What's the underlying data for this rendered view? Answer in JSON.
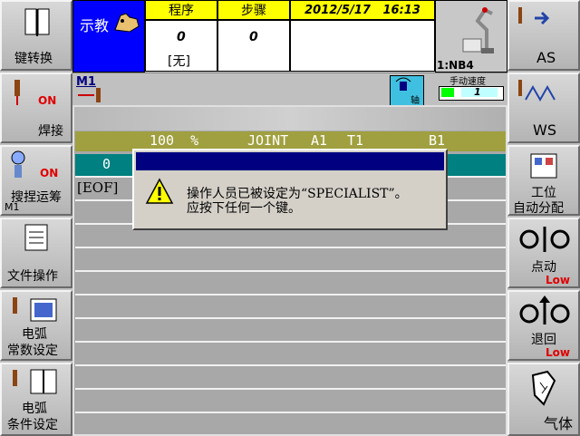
{
  "header": {
    "mode_label": "示教",
    "program_label": "程序",
    "program_value": "0",
    "program_name": "[无]",
    "step_label": "步骤",
    "step_value": "0",
    "datetime": "2012/5/17   16:13",
    "robot_label": "1:NB4",
    "speed_label": "手动速度",
    "speed_value": "1",
    "coord_label": "轴"
  },
  "subheader": {
    "m1_label": "M1"
  },
  "program_view": {
    "status_line": {
      "override": "100  %",
      "coord": "JOINT",
      "axis": "A1",
      "tool": "T1",
      "base": "B1"
    },
    "row0_number": "0",
    "eof_label": "[EOF]"
  },
  "dialog": {
    "message_line1": "操作人员已被设定为“SPECIALIST”。",
    "message_line2": "应按下任何一个键。"
  },
  "left_buttons": [
    {
      "label": "键转换"
    },
    {
      "label": "焊接",
      "badge": "ON"
    },
    {
      "label": "搜捏运筹",
      "badge": "ON",
      "sub": "M1"
    },
    {
      "label": "文件操作"
    },
    {
      "label_line1": "电弧",
      "label_line2": "常数设定"
    },
    {
      "label_line1": "电弧",
      "label_line2": "条件设定"
    }
  ],
  "right_buttons": [
    {
      "label": "AS"
    },
    {
      "label": "WS"
    },
    {
      "label_line1": "工位",
      "label_line2": "自动分配"
    },
    {
      "label": "点动",
      "level": "Low"
    },
    {
      "label": "退回",
      "level": "Low"
    },
    {
      "label": "气体"
    }
  ],
  "colors": {
    "mode_bg": "#0000ff",
    "label_yellow": "#ffff00",
    "status_olive": "#a0a040",
    "row_teal": "#008080",
    "dialog_title": "#000080"
  }
}
